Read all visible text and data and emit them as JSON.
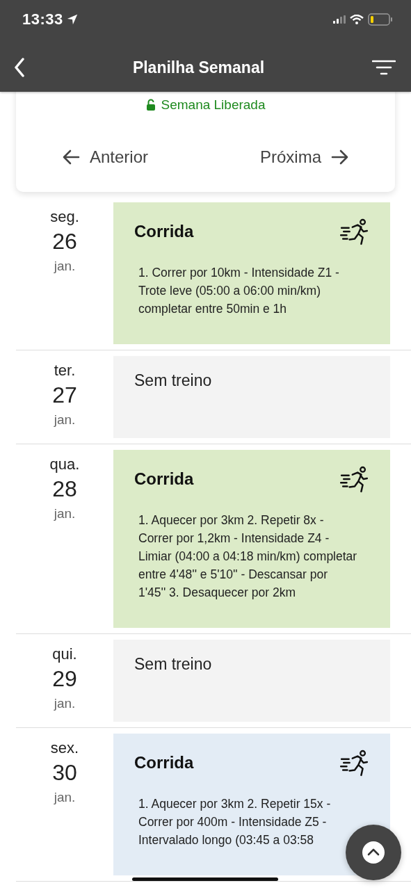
{
  "status_bar": {
    "time": "13:33"
  },
  "nav_bar": {
    "title": "Planilha Semanal"
  },
  "week_card": {
    "status": "Semana Liberada",
    "previous": "Anterior",
    "next": "Próxima"
  },
  "days": [
    {
      "weekday": "seg.",
      "day": "26",
      "month": "jan.",
      "kind": "workout",
      "color": "#dcebc8",
      "title": "Corrida",
      "description": "1. Correr por 10km - Intensidade Z1 - Trote leve (05:00 a 06:00 min/km) completar entre 50min e 1h"
    },
    {
      "weekday": "ter.",
      "day": "27",
      "month": "jan.",
      "kind": "rest",
      "color": "#f3f3f3",
      "title": "Sem treino"
    },
    {
      "weekday": "qua.",
      "day": "28",
      "month": "jan.",
      "kind": "workout",
      "color": "#dcebc8",
      "title": "Corrida",
      "description": "1. Aquecer por 3km  2. Repetir 8x - Correr por 1,2km - Intensidade Z4 - Limiar (04:00 a 04:18 min/km) completar entre 4'48'' e 5'10'' - Descansar por 1'45''  3. Desaquecer por 2km"
    },
    {
      "weekday": "qui.",
      "day": "29",
      "month": "jan.",
      "kind": "rest",
      "color": "#f3f3f3",
      "title": "Sem treino"
    },
    {
      "weekday": "sex.",
      "day": "30",
      "month": "jan.",
      "kind": "workout",
      "color": "#e3ecf5",
      "title": "Corrida",
      "description": "1. Aquecer por 3km  2. Repetir 15x - Correr por 400m - Intensidade Z5 - Intervalado longo (03:45 a 03:58"
    }
  ]
}
